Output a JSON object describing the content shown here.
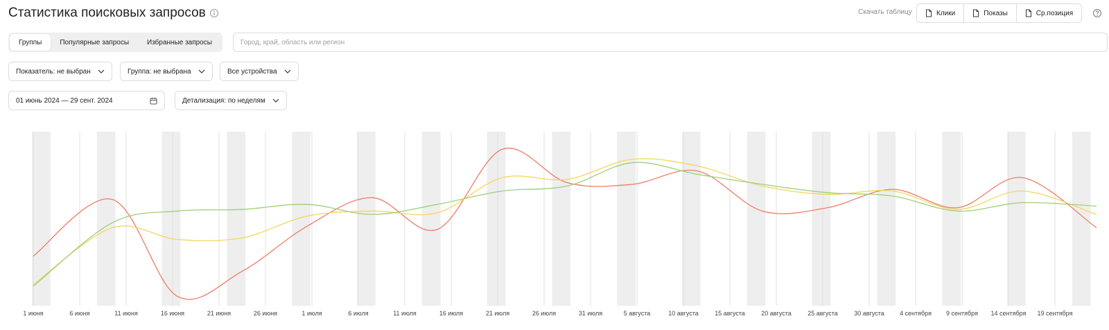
{
  "header": {
    "title": "Статистика поисковых запросов",
    "download_label": "Скачать таблицу",
    "download_buttons": [
      "Клики",
      "Показы",
      "Ср.позиция"
    ]
  },
  "tabs": [
    {
      "label": "Группы",
      "active": true
    },
    {
      "label": "Популярные запросы",
      "active": false
    },
    {
      "label": "Избранные запросы",
      "active": false
    }
  ],
  "search": {
    "placeholder": "Город, край, область или регион",
    "value": ""
  },
  "filters": {
    "indicator": "Показатель: не выбран",
    "group": "Группа: не выбрана",
    "devices": "Все устройства",
    "date_range": "01 июнь 2024 — 29 сент. 2024",
    "detail": "Детализация: по неделям"
  },
  "icons": {
    "title_info": "info-icon",
    "download": "document-icon",
    "help": "help-icon",
    "dropdown": "chevron-down-icon",
    "calendar": "calendar-icon"
  },
  "chart_data": {
    "type": "line",
    "x_axis_labels": [
      "1 июня",
      "6 июня",
      "11 июня",
      "16 июня",
      "21 июня",
      "26 июня",
      "1 июля",
      "6 июля",
      "11 июля",
      "16 июля",
      "21 июля",
      "26 июля",
      "31 июля",
      "5 августа",
      "10 августа",
      "15 августа",
      "20 августа",
      "25 августа",
      "30 августа",
      "4 сентября",
      "9 сентября",
      "14 сентября",
      "19 сентября"
    ],
    "x": [
      "2024-06-01",
      "2024-06-08",
      "2024-06-15",
      "2024-06-22",
      "2024-06-29",
      "2024-07-06",
      "2024-07-13",
      "2024-07-20",
      "2024-07-27",
      "2024-08-03",
      "2024-08-10",
      "2024-08-17",
      "2024-08-24",
      "2024-08-31",
      "2024-09-07",
      "2024-09-14",
      "2024-09-21",
      "2024-09-28"
    ],
    "weekend_shading": true,
    "grid": "vertical",
    "ylim": [
      0,
      100
    ],
    "series": [
      {
        "color": "#f07a66",
        "values": [
          28,
          62,
          4,
          19,
          46,
          63,
          44,
          92,
          72,
          71,
          79,
          55,
          57,
          68,
          57,
          75,
          45
        ]
      },
      {
        "color": "#f5d55e",
        "values": [
          11,
          45,
          38,
          39,
          52,
          55,
          54,
          75,
          74,
          86,
          82,
          70,
          65,
          67,
          56,
          67,
          53
        ]
      },
      {
        "color": "#9ccf77",
        "values": [
          10,
          48,
          55,
          56,
          59,
          53,
          59,
          67,
          70,
          84,
          77,
          71,
          66,
          64,
          55,
          60,
          58
        ]
      }
    ]
  }
}
